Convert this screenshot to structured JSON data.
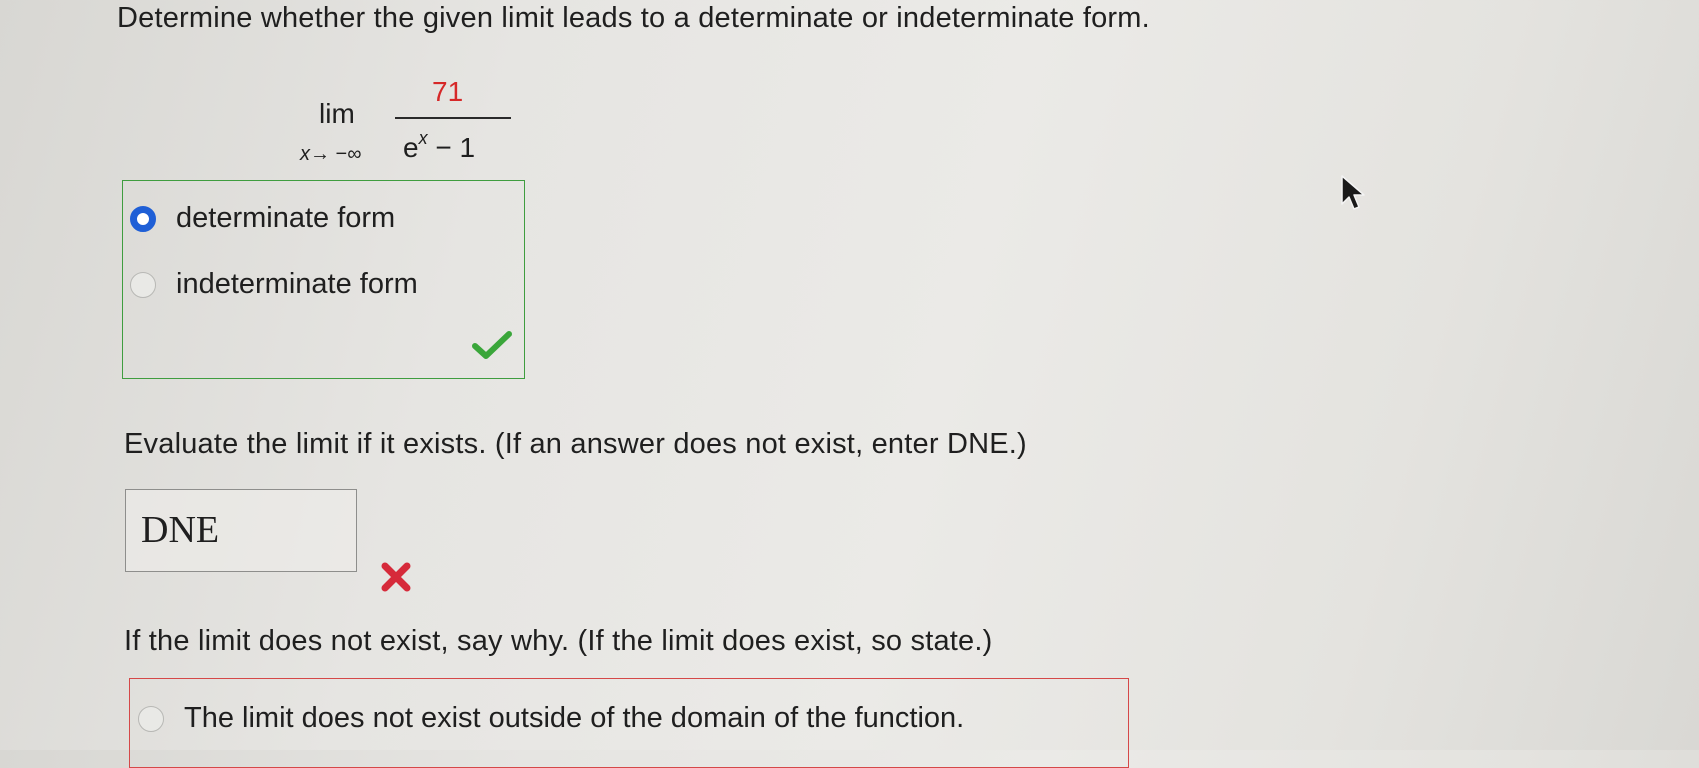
{
  "question1": {
    "prompt": "Determine whether the given limit leads to a determinate or indeterminate form.",
    "limit": {
      "lim_label": "lim",
      "variable": "x",
      "approach": "→ −∞",
      "numerator": "71",
      "denominator_base": "e",
      "denominator_exponent": "x",
      "denominator_rest": "− 1"
    },
    "options": [
      {
        "label": "determinate form",
        "selected": true
      },
      {
        "label": "indeterminate form",
        "selected": false
      }
    ],
    "result_icon": "checkmark-icon",
    "status": "correct"
  },
  "question2": {
    "prompt": "Evaluate the limit if it exists. (If an answer does not exist, enter DNE.)",
    "answer_value": "DNE",
    "result_icon": "x-mark-icon",
    "status": "incorrect"
  },
  "question3": {
    "prompt": "If the limit does not exist, say why. (If the limit does exist, so state.)",
    "options": [
      {
        "label": "The limit does not exist outside of the domain of the function.",
        "selected": false
      }
    ]
  },
  "colors": {
    "selected_radio": "#1f5fd6",
    "correct_border": "#3f9d3f",
    "correct_check": "#3aa63a",
    "incorrect_border": "#d54848",
    "incorrect_mark": "#d62a3a",
    "numerator": "#d62828"
  }
}
